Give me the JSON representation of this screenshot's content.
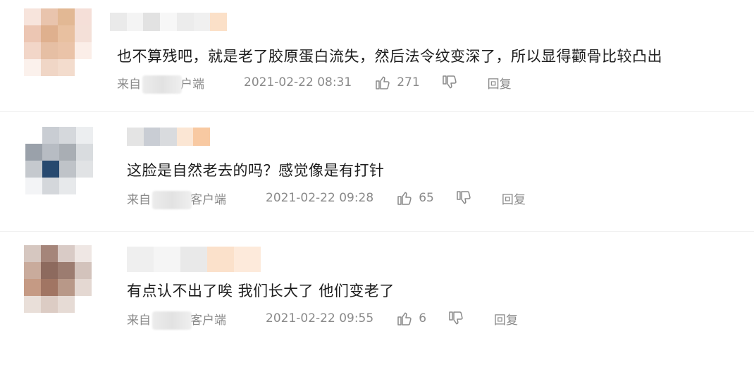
{
  "comments": [
    {
      "text": "也不算残吧，就是老了胶原蛋白流失，然后法令纹变深了，所以显得颧骨比较凸出",
      "source_prefix": "来自",
      "source_suffix": "户端",
      "time": "2021-02-22 08:31",
      "likes": "271",
      "reply_label": "回复",
      "avatar_palette": [
        "#f7e4dc",
        "#e9c4ad",
        "#e2b894",
        "#f5dfd8",
        "#ecc6b3",
        "#dfb08e",
        "#e8c0a0",
        "#f4e0d8",
        "#f2d6c8",
        "#e6bfa4",
        "#eac3a8",
        "#fbeee8",
        "#fbf1ec",
        "#f0d6c6",
        "#f3dccd",
        "#ffffff"
      ],
      "name_palette": [
        "#eaeaea",
        "#f4f4f4",
        "#e2e2e2",
        "#f7f7f7",
        "#ececec",
        "#f0f0f0",
        "#fbe0c8"
      ]
    },
    {
      "text": "这脸是自然老去的吗？感觉像是有打针",
      "source_prefix": "来自",
      "source_suffix": "客户端",
      "time": "2021-02-22 09:28",
      "likes": "65",
      "reply_label": "回复",
      "avatar_palette": [
        "#ffffff",
        "#c9cdd3",
        "#d5d8dc",
        "#eceef0",
        "#9aa1aa",
        "#b7bcc3",
        "#a9aeb4",
        "#d9dcdf",
        "#c5c9ce",
        "#27496f",
        "#bfc3c8",
        "#e1e3e5",
        "#f3f4f6",
        "#d4d7db",
        "#e7e9eb",
        "#ffffff"
      ],
      "name_palette": [
        "#e4e4e4",
        "#c9cdd4",
        "#d9dbde",
        "#fbe6d4",
        "#f8c9a2"
      ]
    },
    {
      "text": "有点认不出了唉 我们长大了 他们变老了",
      "source_prefix": "来自",
      "source_suffix": "客户端",
      "time": "2021-02-22 09:55",
      "likes": "6",
      "reply_label": "回复",
      "avatar_palette": [
        "#d6c7c0",
        "#a5857a",
        "#d9cbc6",
        "#efe7e4",
        "#c9ab9c",
        "#8d6a5e",
        "#9c7c70",
        "#d3c3bc",
        "#c59a84",
        "#a17563",
        "#b89888",
        "#e4d8d2",
        "#e9dfd9",
        "#dcccc4",
        "#e6dbd5",
        "#ffffff"
      ],
      "name_palette": [
        "#efefef",
        "#f5f5f5",
        "#e9e9e9",
        "#fbe1cb",
        "#fdeadb"
      ]
    }
  ]
}
